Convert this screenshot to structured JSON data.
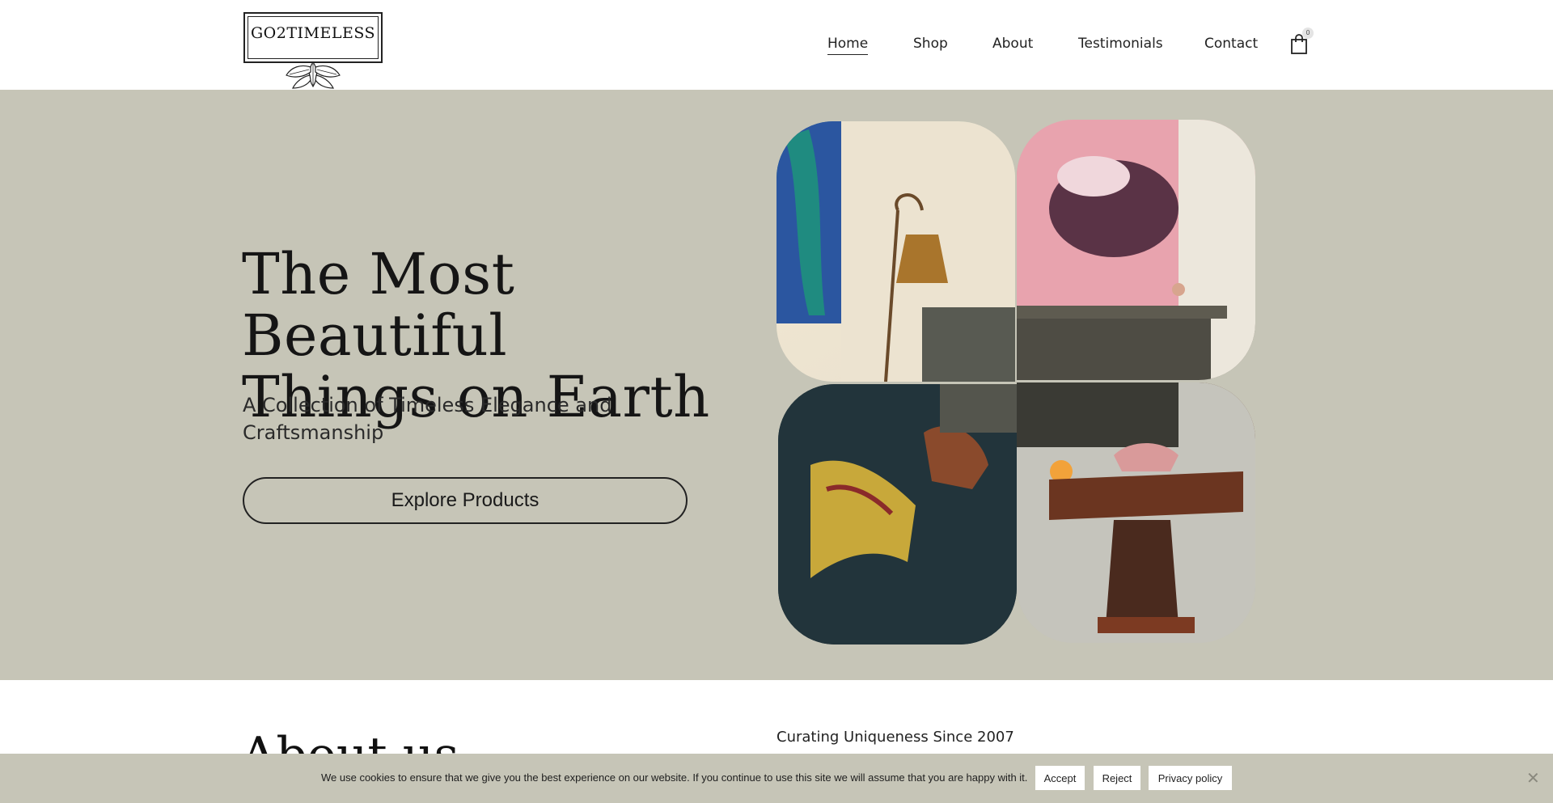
{
  "brand": {
    "logo_text": "GO2TIMELESS"
  },
  "nav": {
    "items": [
      {
        "label": "Home",
        "active": true
      },
      {
        "label": "Shop"
      },
      {
        "label": "About"
      },
      {
        "label": "Testimonials"
      },
      {
        "label": "Contact"
      }
    ],
    "cart_count": "0",
    "cart_icon": "shopping-bag-icon"
  },
  "hero": {
    "title_line1": "The Most Beautiful",
    "title_line2": "Things on Earth",
    "subtitle": "A Collection of Timeless Elegance and Craftsmanship",
    "cta_label": "Explore Products",
    "background_color": "#c6c5b7"
  },
  "about": {
    "title": "About us",
    "tagline": "Curating Uniqueness Since 2007"
  },
  "cookie_bar": {
    "message": "We use cookies to ensure that we give you the best experience on our website. If you continue to use this site we will assume that you are happy with it.",
    "accept_label": "Accept",
    "reject_label": "Reject",
    "privacy_label": "Privacy policy",
    "close_icon": "close-icon"
  }
}
